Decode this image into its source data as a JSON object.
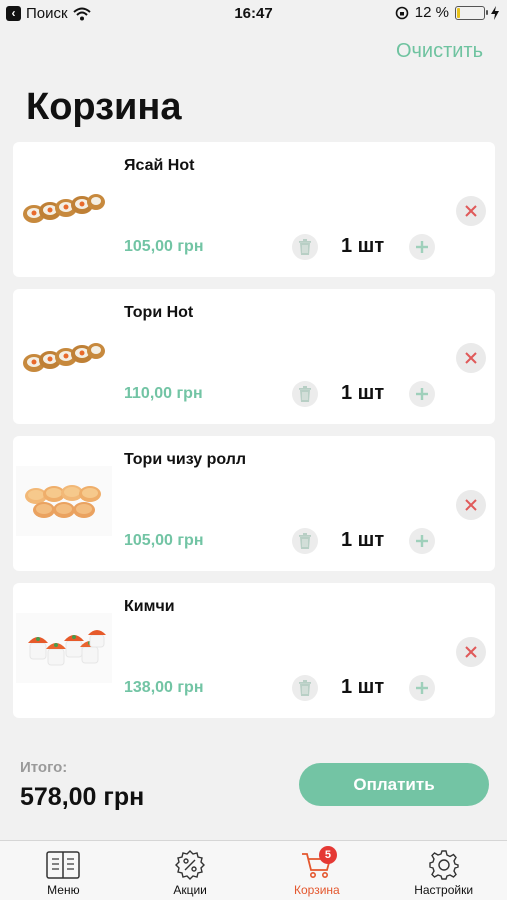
{
  "status_bar": {
    "back_app": "Поиск",
    "time": "16:47",
    "battery": "12 %"
  },
  "header": {
    "clear_label": "Очистить",
    "title": "Корзина"
  },
  "cart": {
    "items": [
      {
        "name": "Ясай Hot",
        "price": "105,00 грн",
        "qty": "1 шт",
        "image": "roll-hot"
      },
      {
        "name": "Тори Hot",
        "price": "110,00 грн",
        "qty": "1 шт",
        "image": "roll-hot"
      },
      {
        "name": "Тори чизу ролл",
        "price": "105,00 грн",
        "qty": "1 шт",
        "image": "roll-cheese"
      },
      {
        "name": "Кимчи",
        "price": "138,00 грн",
        "qty": "1 шт",
        "image": "gunkan-kimchi"
      }
    ]
  },
  "summary": {
    "total_label": "Итого:",
    "total_value": "578,00 грн",
    "pay_label": "Оплатить"
  },
  "tabbar": {
    "items": [
      {
        "label": "Меню",
        "icon": "menu-book-icon"
      },
      {
        "label": "Акции",
        "icon": "discount-icon"
      },
      {
        "label": "Корзина",
        "icon": "cart-icon",
        "badge": "5",
        "active": true
      },
      {
        "label": "Настройки",
        "icon": "gear-icon"
      }
    ]
  },
  "colors": {
    "accent": "#73c4a4",
    "active_tab": "#e4572e",
    "badge": "#e53935",
    "remove_x": "#e05a5a"
  }
}
